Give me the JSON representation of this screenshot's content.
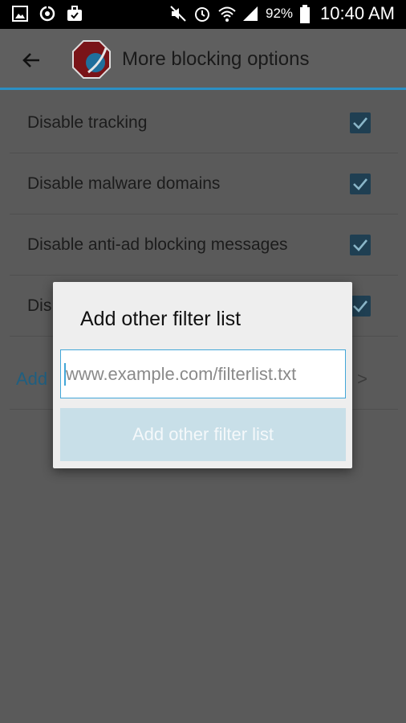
{
  "status_bar": {
    "icons_left": [
      "gallery-icon",
      "sync-icon",
      "briefcase-icon"
    ],
    "icons_right": [
      "mute-icon",
      "alarm-icon",
      "wifi-icon",
      "signal-icon"
    ],
    "battery": "92%",
    "time": "10:40 AM"
  },
  "app_bar": {
    "title": "More blocking options"
  },
  "options": [
    {
      "label": "Disable tracking",
      "checked": true
    },
    {
      "label": "Disable malware domains",
      "checked": true
    },
    {
      "label": "Disable anti-ad blocking messages",
      "checked": true
    },
    {
      "label": "Dis",
      "checked": true
    }
  ],
  "add_row": {
    "label": "Add",
    "arrow": ">"
  },
  "dialog": {
    "title": "Add other filter list",
    "input_placeholder": "www.example.com/filterlist.txt",
    "button_label": "Add other filter list"
  },
  "colors": {
    "accent": "#2b8fc4",
    "checkbox": "#1f3f52",
    "button_disabled": "#c8dfe8"
  }
}
